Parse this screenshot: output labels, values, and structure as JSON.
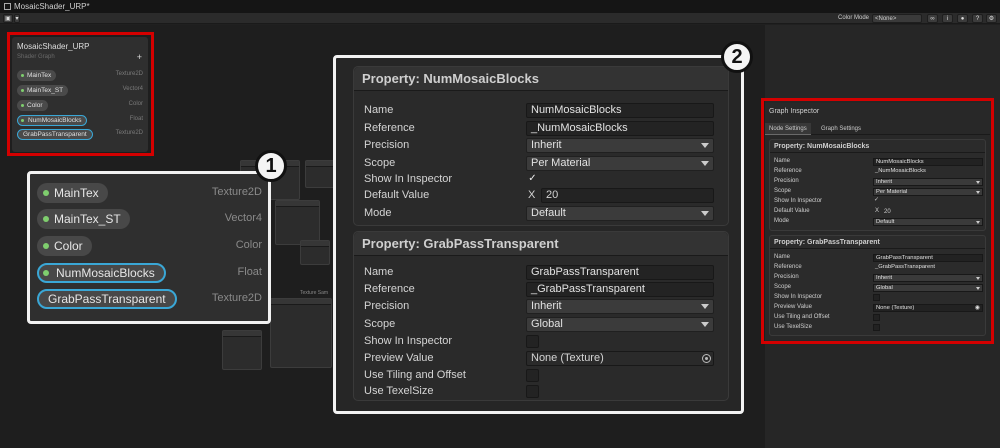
{
  "window": {
    "title": "MosaicShader_URP*"
  },
  "toolbar": {
    "color_mode_label": "Color Mode",
    "color_mode_value": "<None>"
  },
  "blackboard": {
    "title": "MosaicShader_URP",
    "subtitle": "Shader Graph",
    "add_label": "+",
    "items": [
      {
        "name": "MainTex",
        "type": "Texture2D",
        "dot": true,
        "selected": false
      },
      {
        "name": "MainTex_ST",
        "type": "Vector4",
        "dot": true,
        "selected": false
      },
      {
        "name": "Color",
        "type": "Color",
        "dot": true,
        "selected": false
      },
      {
        "name": "NumMosaicBlocks",
        "type": "Float",
        "dot": true,
        "selected": true
      },
      {
        "name": "GrabPassTransparent",
        "type": "Texture2D",
        "dot": false,
        "selected": true
      }
    ]
  },
  "canvas": {
    "node_texture_label": "Texture Sam"
  },
  "badges": {
    "one": "1",
    "two": "2"
  },
  "properties": [
    {
      "title": "Property: NumMosaicBlocks",
      "name_label": "Name",
      "name_value": "NumMosaicBlocks",
      "reference_label": "Reference",
      "reference_value": "_NumMosaicBlocks",
      "precision_label": "Precision",
      "precision_value": "Inherit",
      "scope_label": "Scope",
      "scope_value": "Per Material",
      "show_inspector_label": "Show In Inspector",
      "show_inspector_checked": true,
      "default_label": "Default Value",
      "default_axis": "X",
      "default_value": "20",
      "mode_label": "Mode",
      "mode_value": "Default"
    },
    {
      "title": "Property: GrabPassTransparent",
      "name_label": "Name",
      "name_value": "GrabPassTransparent",
      "reference_label": "Reference",
      "reference_value": "_GrabPassTransparent",
      "precision_label": "Precision",
      "precision_value": "Inherit",
      "scope_label": "Scope",
      "scope_value": "Global",
      "show_inspector_label": "Show In Inspector",
      "show_inspector_checked": false,
      "preview_label": "Preview Value",
      "preview_value": "None (Texture)",
      "tiling_label": "Use Tiling and Offset",
      "tiling_checked": false,
      "texelsize_label": "Use TexelSize",
      "texelsize_checked": false
    }
  ],
  "inspector": {
    "title": "Graph Inspector",
    "tabs": [
      "Node Settings",
      "Graph Settings"
    ],
    "active_tab": 0
  },
  "colors": {
    "highlight_red": "#d40000",
    "highlight_white": "#f2f2f2",
    "selected_blue": "#3aa7d6",
    "dot_green": "#7fce6e"
  }
}
